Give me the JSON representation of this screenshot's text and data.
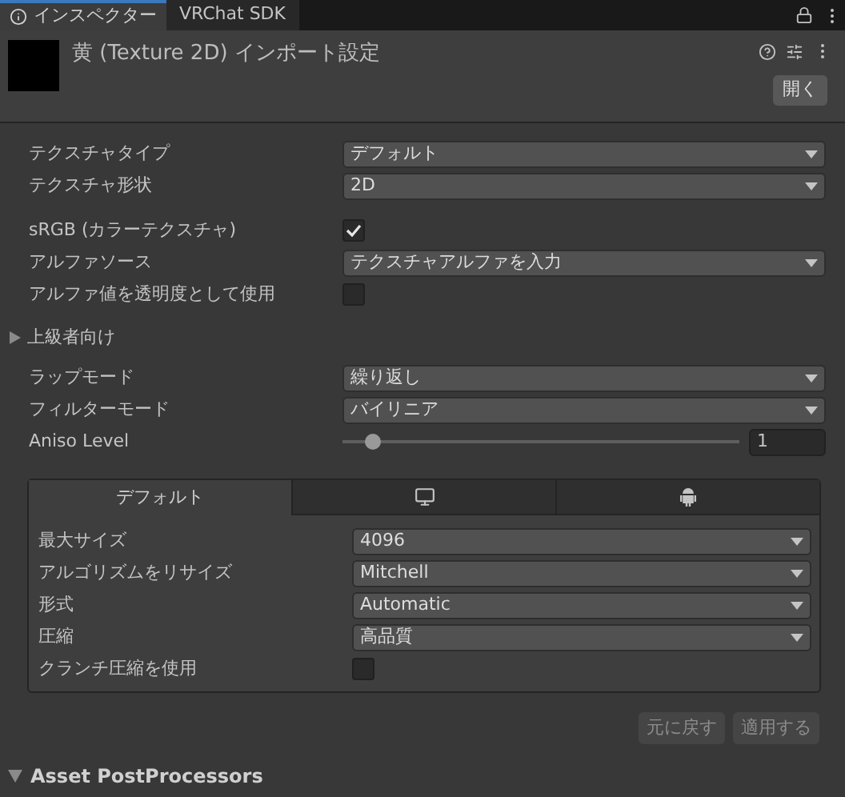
{
  "tabs": [
    {
      "label": "インスペクター",
      "selected": true
    },
    {
      "label": "VRChat SDK",
      "selected": false
    }
  ],
  "header": {
    "title": "黄 (Texture 2D) インポート設定",
    "open_button": "開く"
  },
  "groups": [
    [
      {
        "kind": "dropdown",
        "label": "テクスチャタイプ",
        "value": "デフォルト"
      },
      {
        "kind": "dropdown",
        "label": "テクスチャ形状",
        "value": "2D"
      }
    ],
    [
      {
        "kind": "checkbox",
        "label": "sRGB (カラーテクスチャ)",
        "checked": true
      },
      {
        "kind": "dropdown",
        "label": "アルファソース",
        "value": "テクスチャアルファを入力"
      },
      {
        "kind": "checkbox",
        "label": "アルファ値を透明度として使用",
        "checked": false
      }
    ]
  ],
  "advanced": {
    "label": "上級者向け",
    "expanded": false
  },
  "sampling": [
    {
      "kind": "dropdown",
      "label": "ラップモード",
      "value": "繰り返し"
    },
    {
      "kind": "dropdown",
      "label": "フィルターモード",
      "value": "バイリニア"
    },
    {
      "kind": "slider",
      "label": "Aniso Level",
      "level": 0.06,
      "reading": "1"
    }
  ],
  "platform": {
    "tabs": [
      {
        "kind": "text",
        "label": "デフォルト",
        "selected": true
      },
      {
        "kind": "monitor",
        "selected": false
      },
      {
        "kind": "android",
        "selected": false
      }
    ],
    "rows": [
      {
        "kind": "dropdown",
        "label": "最大サイズ",
        "value": "4096"
      },
      {
        "kind": "dropdown",
        "label": "アルゴリズムをリサイズ",
        "value": "Mitchell"
      },
      {
        "kind": "dropdown",
        "label": "形式",
        "value": "Automatic"
      },
      {
        "kind": "dropdown",
        "label": "圧縮",
        "value": "高品質"
      },
      {
        "kind": "checkbox",
        "label": "クランチ圧縮を使用",
        "checked": false
      }
    ]
  },
  "buttons": [
    {
      "label": "元に戻す",
      "disabled": true
    },
    {
      "label": "適用する",
      "disabled": true
    }
  ],
  "footer": {
    "label": "Asset PostProcessors",
    "expanded": true
  }
}
